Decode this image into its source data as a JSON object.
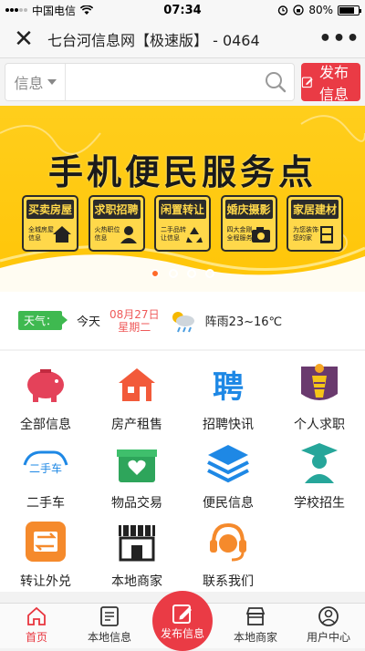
{
  "status_bar": {
    "carrier": "中国电信",
    "time": "07:34",
    "battery": "80%"
  },
  "nav": {
    "title": "七台河信息网【极速版】 - 0464",
    "close_icon": "close-icon",
    "more_icon": "more-icon"
  },
  "search": {
    "category": "信息",
    "value": "",
    "publish_label": "发布信息"
  },
  "banner": {
    "title": "手机便民服务点",
    "tiles": [
      {
        "head": "买卖房屋",
        "sub": "全城房屋信息"
      },
      {
        "head": "求职招聘",
        "sub": "火热职位信息"
      },
      {
        "head": "闲置转让",
        "sub": "二手品转让信息"
      },
      {
        "head": "婚庆摄影",
        "sub": "四大金刚全程服务"
      },
      {
        "head": "家居建材",
        "sub": "为您装饰您的家"
      }
    ],
    "slides": 4,
    "active_slide": 1
  },
  "weather": {
    "tag": "天气：",
    "today": "今天",
    "date": "08月27日",
    "weekday": "星期二",
    "desc": "阵雨23~16℃"
  },
  "grid": [
    {
      "label": "全部信息",
      "icon": "piggy-bank-icon"
    },
    {
      "label": "房产租售",
      "icon": "house-icon"
    },
    {
      "label": "招聘快讯",
      "icon": "recruit-icon"
    },
    {
      "label": "个人求职",
      "icon": "job-seeker-icon"
    },
    {
      "label": "二手车",
      "icon": "used-car-icon"
    },
    {
      "label": "物品交易",
      "icon": "goods-trade-icon"
    },
    {
      "label": "便民信息",
      "icon": "layers-icon"
    },
    {
      "label": "学校招生",
      "icon": "graduate-icon"
    },
    {
      "label": "转让外兑",
      "icon": "transfer-icon"
    },
    {
      "label": "本地商家",
      "icon": "store-icon"
    },
    {
      "label": "联系我们",
      "icon": "customer-service-icon"
    }
  ],
  "tabbar": [
    {
      "label": "首页",
      "icon": "home-icon"
    },
    {
      "label": "本地信息",
      "icon": "local-info-icon"
    },
    {
      "label": "发布信息",
      "icon": "publish-icon"
    },
    {
      "label": "本地商家",
      "icon": "shop-icon"
    },
    {
      "label": "用户中心",
      "icon": "user-icon"
    }
  ],
  "colors": {
    "accent": "#ea3b45",
    "banner": "#ffc507",
    "weather_tag": "#3fb950"
  }
}
